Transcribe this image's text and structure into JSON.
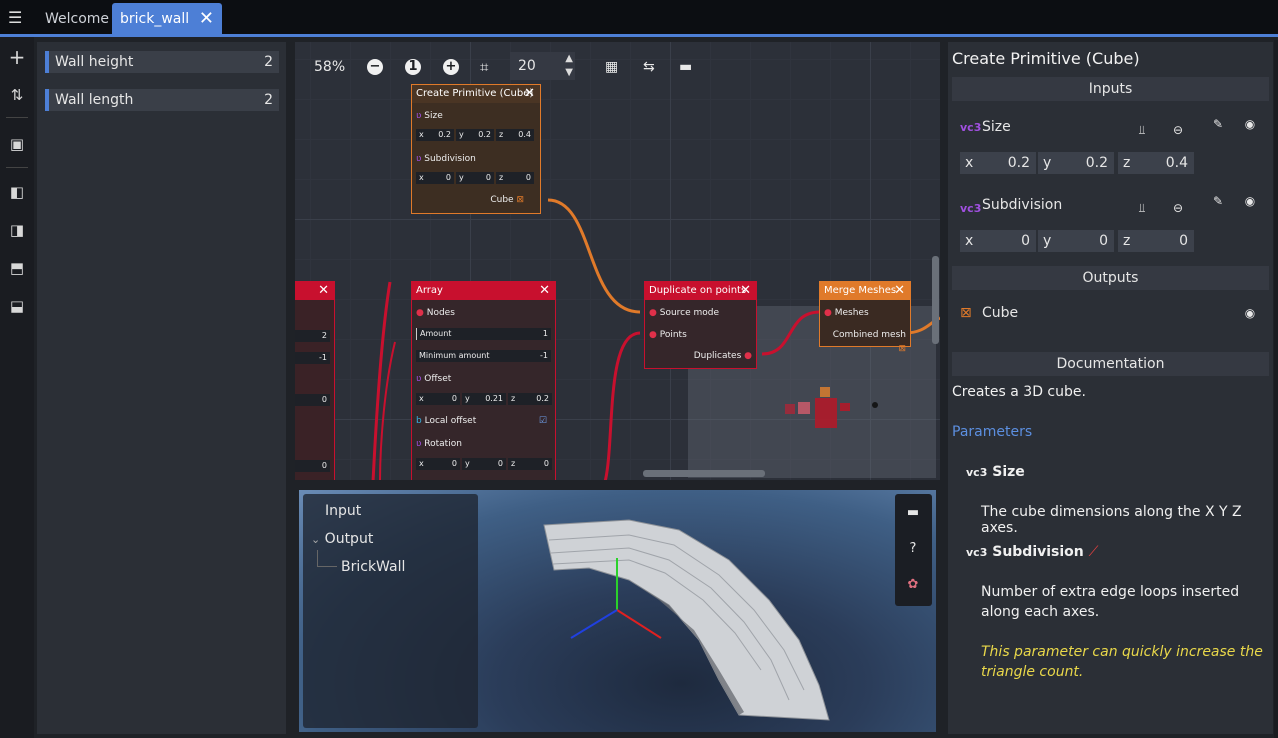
{
  "tabs": {
    "welcome": "Welcome",
    "active": "brick_wall",
    "close_glyph": "✕"
  },
  "variables": [
    {
      "label": "Wall height",
      "value": "2"
    },
    {
      "label": "Wall length",
      "value": "2"
    }
  ],
  "graph_toolbar": {
    "zoom": "58%",
    "snap_value": "20",
    "zoom_out": "−",
    "zoom_reset": "1",
    "zoom_in": "+"
  },
  "nodes": {
    "create_primitive": {
      "title": "Create Primitive (Cube)",
      "size_label": "Size",
      "sub_label": "Subdivision",
      "x": "0.2",
      "y": "0.2",
      "z": "0.4",
      "sx": "0",
      "sy": "0",
      "sz": "0",
      "out": "Cube"
    },
    "array": {
      "title": "Array",
      "nodes": "Nodes",
      "amount": "Amount",
      "amount_val": "1",
      "min_amount": "Minimum amount",
      "min_val": "-1",
      "offset": "Offset",
      "ox": "0",
      "oy": "0.21",
      "oz": "0.2",
      "local_offset": "Local offset",
      "rotation": "Rotation",
      "rx": "0",
      "ry": "0",
      "rz": "0"
    },
    "left_partial": {
      "v1": "2",
      "v2": "-1",
      "v3": "0",
      "v4": "0"
    },
    "duplicate": {
      "title": "Duplicate on points",
      "source": "Source mode",
      "points": "Points",
      "out": "Duplicates"
    },
    "merge": {
      "title": "Merge Meshes",
      "meshes": "Meshes",
      "out": "Combined mesh"
    }
  },
  "axis_labels": {
    "x": "x",
    "y": "y",
    "z": "z"
  },
  "outliner": {
    "input": "Input",
    "output": "Output",
    "child": "BrickWall"
  },
  "viewport_tools": {
    "help": "?"
  },
  "inspector": {
    "title": "Create Primitive (Cube)",
    "inputs_header": "Inputs",
    "size": {
      "label": "Size",
      "type": "vc3",
      "x": "0.2",
      "y": "0.2",
      "z": "0.4"
    },
    "subdivision": {
      "label": "Subdivision",
      "type": "vc3",
      "x": "0",
      "y": "0",
      "z": "0"
    },
    "outputs_header": "Outputs",
    "cube_out": "Cube",
    "documentation_header": "Documentation",
    "doc_summary": "Creates a 3D cube.",
    "parameters_label": "Parameters",
    "param_size": "Size",
    "param_size_desc": "The cube dimensions along the X Y Z axes.",
    "param_sub": "Subdivision",
    "param_sub_desc_1": "Number of extra edge loops inserted",
    "param_sub_desc_2": "along each axes.",
    "warning_1": "This parameter can quickly increase the",
    "warning_2": "triangle count."
  },
  "colors": {
    "accent": "#4d7fd6",
    "node_orange": "#e07a2a",
    "node_red": "#c8102e",
    "warning": "#e9d84a"
  }
}
